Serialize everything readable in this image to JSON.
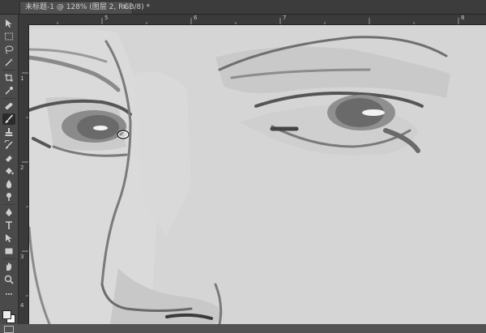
{
  "document": {
    "tab_title": "未标题-1 @ 128% (图层 2, RGB/8) *",
    "close_glyph": "×",
    "zoom": "128%"
  },
  "rulers": {
    "top_labels": [
      "5",
      "6",
      "7",
      "8"
    ],
    "left_labels": [
      "1",
      "2",
      "3",
      "4"
    ]
  },
  "tools": [
    "move-tool-icon",
    "marquee-tool-icon",
    "lasso-tool-icon",
    "magic-wand-tool-icon",
    "crop-tool-icon",
    "eyedropper-tool-icon",
    "healing-brush-tool-icon",
    "brush-tool-icon",
    "clone-stamp-tool-icon",
    "history-brush-tool-icon",
    "eraser-tool-icon",
    "paint-bucket-tool-icon",
    "blur-tool-icon",
    "dodge-tool-icon",
    "pen-tool-icon",
    "type-tool-icon",
    "path-selection-tool-icon",
    "rectangle-tool-icon",
    "hand-tool-icon",
    "zoom-tool-icon"
  ],
  "active_tool": "brush-tool-icon",
  "colors": {
    "foreground": "#ececec",
    "background": "#ffffff",
    "canvas_paper": "#d5d5d5",
    "ui_panel": "#4a4a4a"
  }
}
